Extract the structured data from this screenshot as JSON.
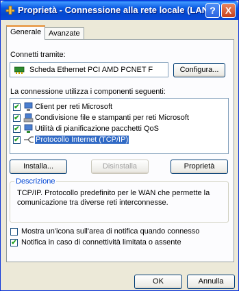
{
  "window": {
    "title": "Proprietà - Connessione alla rete locale (LAN)",
    "help_glyph": "?",
    "close_glyph": "X"
  },
  "tabs": [
    {
      "label": "Generale",
      "active": true
    },
    {
      "label": "Avanzate",
      "active": false
    }
  ],
  "connect_using": {
    "label": "Connetti tramite:",
    "adapter_name": "Scheda Ethernet PCI AMD PCNET F",
    "configure_button": "Configura..."
  },
  "components": {
    "label": "La connessione utilizza i componenti seguenti:",
    "items": [
      {
        "label": "Client per reti Microsoft",
        "checked": true,
        "icon": "network-client-icon"
      },
      {
        "label": "Condivisione file e stampanti per reti Microsoft",
        "checked": true,
        "icon": "file-printer-sharing-icon"
      },
      {
        "label": "Utilità di pianificazione pacchetti QoS",
        "checked": true,
        "icon": "qos-scheduler-icon"
      },
      {
        "label": "Protocollo Internet (TCP/IP)",
        "checked": true,
        "selected": true,
        "icon": "network-protocol-icon"
      }
    ]
  },
  "buttons": {
    "install": "Installa...",
    "uninstall": "Disinstalla",
    "properties": "Proprietà"
  },
  "description": {
    "title": "Descrizione",
    "text": "TCP/IP. Protocollo predefinito per le WAN che permette la comunicazione tra diverse reti interconnesse."
  },
  "options": [
    {
      "label": "Mostra un'icona sull'area di notifica quando connesso",
      "checked": false
    },
    {
      "label": "Notifica in caso di connettività limitata o assente",
      "checked": true
    }
  ],
  "footer": {
    "ok": "OK",
    "cancel": "Annulla"
  },
  "colors": {
    "titlebar": "#0a4bd8",
    "selection": "#316ac5",
    "check": "#21a121",
    "group_title": "#0046d5"
  }
}
